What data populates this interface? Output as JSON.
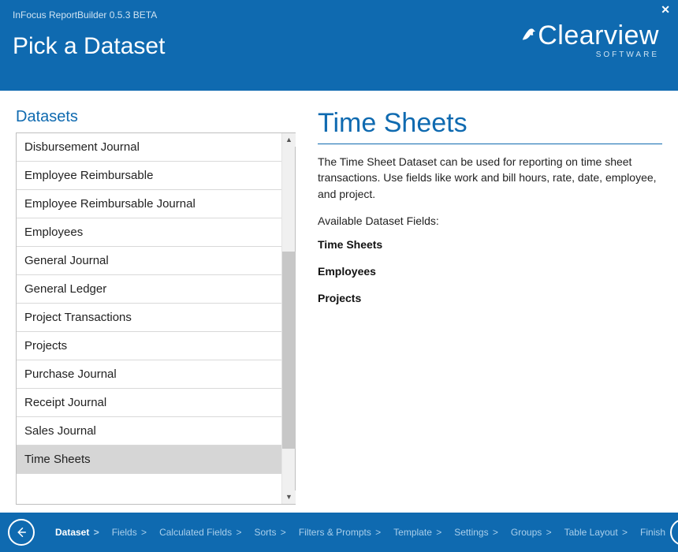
{
  "header": {
    "app_subtitle": "InFocus ReportBuilder 0.5.3 BETA",
    "page_title": "Pick a Dataset",
    "logo_text_a": "Clear",
    "logo_text_b": "view",
    "logo_sub": "SOFTWARE"
  },
  "left": {
    "section_title": "Datasets",
    "items": [
      "Disbursement Journal",
      "Employee Reimbursable",
      "Employee Reimbursable Journal",
      "Employees",
      "General Journal",
      "General Ledger",
      "Project Transactions",
      "Projects",
      "Purchase Journal",
      "Receipt Journal",
      "Sales Journal",
      "Time Sheets"
    ],
    "selected_index": 11
  },
  "detail": {
    "title": "Time Sheets",
    "description": "The Time Sheet Dataset can be used for reporting on time sheet transactions. Use fields like work and bill hours, rate, date, employee, and project.",
    "available_label": "Available Dataset Fields:",
    "fields": [
      "Time Sheets",
      "Employees",
      "Projects"
    ]
  },
  "footer": {
    "crumbs": [
      {
        "label": "Dataset",
        "active": true,
        "chevron": true
      },
      {
        "label": "Fields",
        "active": false,
        "chevron": true
      },
      {
        "label": "Calculated Fields",
        "active": false,
        "chevron": true
      },
      {
        "label": "Sorts",
        "active": false,
        "chevron": true
      },
      {
        "label": "Filters & Prompts",
        "active": false,
        "chevron": true
      },
      {
        "label": "Template",
        "active": false,
        "chevron": true
      },
      {
        "label": "Settings",
        "active": false,
        "chevron": true
      },
      {
        "label": "Groups",
        "active": false,
        "chevron": true
      },
      {
        "label": "Table Layout",
        "active": false,
        "chevron": true
      },
      {
        "label": "Finish",
        "active": false,
        "chevron": false
      }
    ]
  }
}
